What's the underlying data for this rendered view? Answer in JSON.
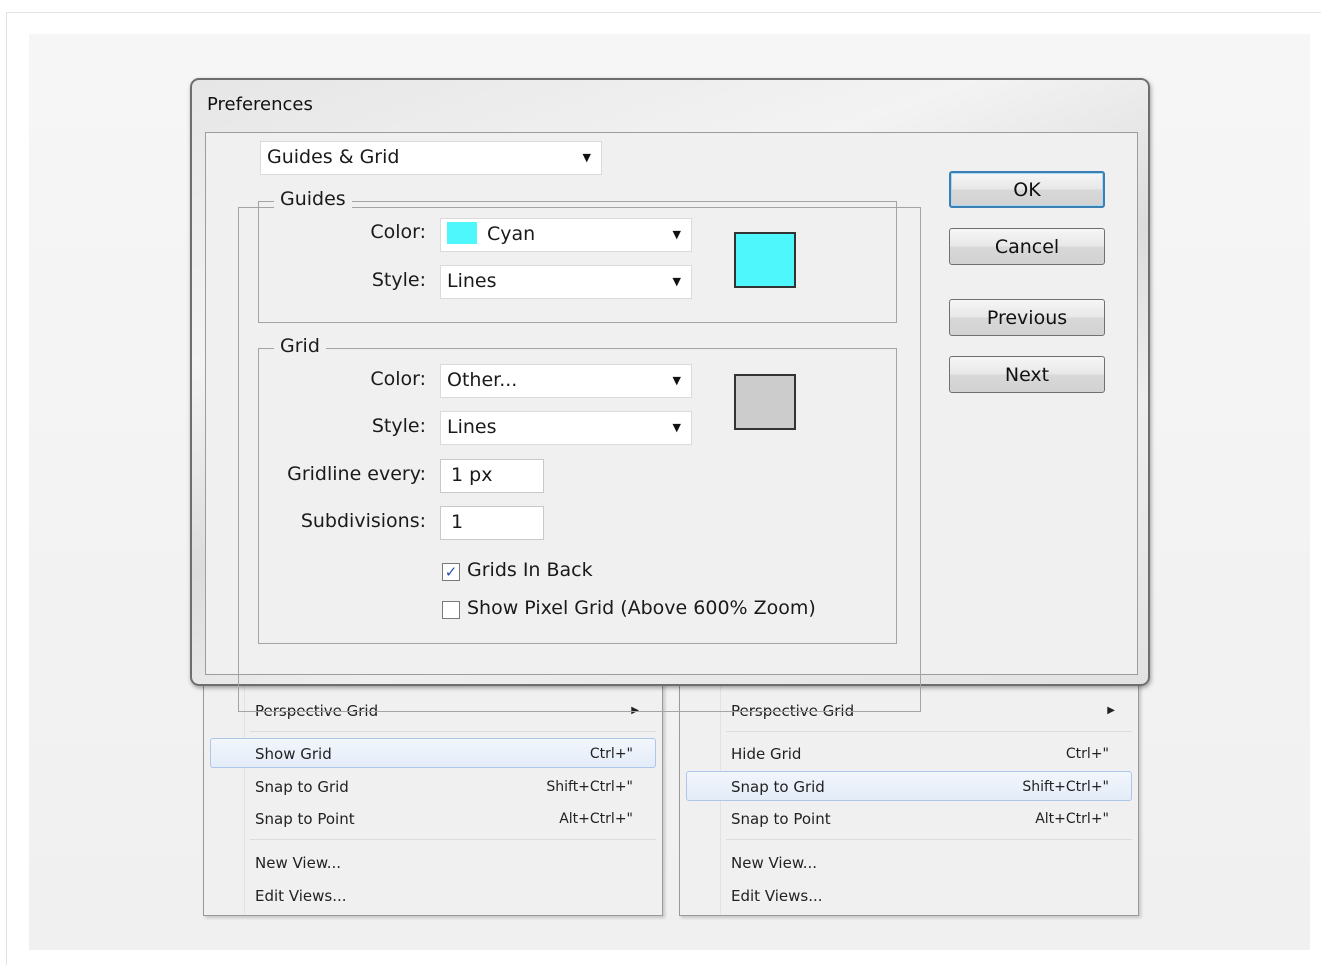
{
  "dialog": {
    "title": "Preferences",
    "section": "Guides & Grid",
    "guides": {
      "legend": "Guides",
      "color_label": "Color:",
      "color_value": "Cyan",
      "color_swatch": "#4df7fb",
      "style_label": "Style:",
      "style_value": "Lines"
    },
    "grid": {
      "legend": "Grid",
      "color_label": "Color:",
      "color_value": "Other...",
      "color_swatch": "#cccccc",
      "style_label": "Style:",
      "style_value": "Lines",
      "gridline_label": "Gridline every:",
      "gridline_value": "1 px",
      "subdivisions_label": "Subdivisions:",
      "subdivisions_value": "1",
      "grids_in_back_label": "Grids In Back",
      "grids_in_back_checked": true,
      "pixel_grid_label": "Show Pixel Grid (Above 600% Zoom)",
      "pixel_grid_checked": false
    },
    "buttons": {
      "ok": "OK",
      "cancel": "Cancel",
      "previous": "Previous",
      "next": "Next"
    }
  },
  "menu_left": {
    "perspective": "Perspective Grid",
    "items": [
      {
        "label": "Show Grid",
        "shortcut": "Ctrl+\"",
        "highlighted": true
      },
      {
        "label": "Snap to Grid",
        "shortcut": "Shift+Ctrl+\""
      },
      {
        "label": "Snap to Point",
        "shortcut": "Alt+Ctrl+\""
      }
    ],
    "new_view": "New View...",
    "edit_views": "Edit Views..."
  },
  "menu_right": {
    "perspective": "Perspective Grid",
    "items": [
      {
        "label": "Hide Grid",
        "shortcut": "Ctrl+\""
      },
      {
        "label": "Snap to Grid",
        "shortcut": "Shift+Ctrl+\"",
        "highlighted": true
      },
      {
        "label": "Snap to Point",
        "shortcut": "Alt+Ctrl+\""
      }
    ],
    "new_view": "New View...",
    "edit_views": "Edit Views..."
  }
}
